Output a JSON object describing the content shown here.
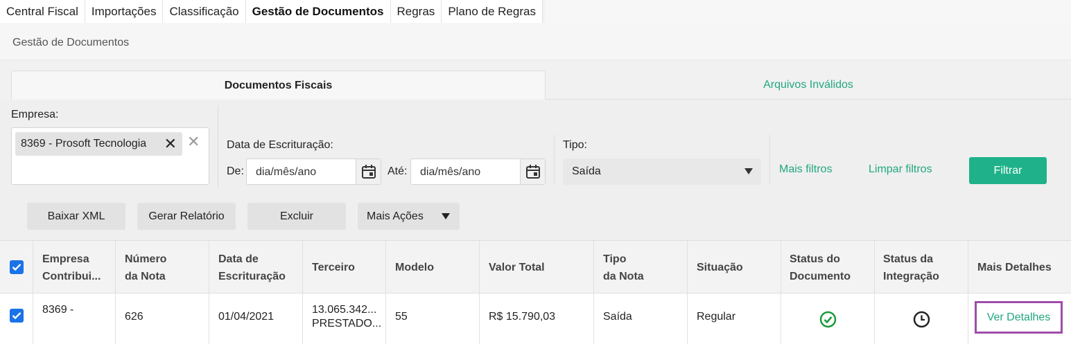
{
  "nav": {
    "tabs": [
      {
        "label": "Central Fiscal"
      },
      {
        "label": "Importações"
      },
      {
        "label": "Classificação"
      },
      {
        "label": "Gestão de Documentos",
        "active": true
      },
      {
        "label": "Regras"
      },
      {
        "label": "Plano de Regras"
      }
    ]
  },
  "breadcrumb": "Gestão de Documentos",
  "doc_tabs": {
    "active": "Documentos Fiscais",
    "inactive": "Arquivos Inválidos"
  },
  "filters": {
    "empresa_label": "Empresa:",
    "empresa_chip": "8369 - Prosoft Tecnologia",
    "data_label": "Data de Escrituração:",
    "de_label": "De:",
    "ate_label": "Até:",
    "date_placeholder": "dia/mês/ano",
    "tipo_label": "Tipo:",
    "tipo_value": "Saída",
    "mais_filtros": "Mais filtros",
    "limpar_filtros": "Limpar filtros",
    "filtrar": "Filtrar"
  },
  "actions": {
    "baixar_xml": "Baixar XML",
    "gerar_relatorio": "Gerar Relatório",
    "excluir": "Excluir",
    "mais_acoes": "Mais Ações"
  },
  "table": {
    "headers": {
      "empresa": [
        "Empresa",
        "Contribui..."
      ],
      "numero": [
        "Número",
        "da Nota"
      ],
      "data": [
        "Data de",
        "Escrituração"
      ],
      "terceiro": [
        "Terceiro"
      ],
      "modelo": [
        "Modelo"
      ],
      "valor": [
        "Valor Total"
      ],
      "tipo": [
        "Tipo",
        "da Nota"
      ],
      "situacao": [
        "Situação"
      ],
      "status_doc": [
        "Status do",
        "Documento"
      ],
      "status_int": [
        "Status da",
        "Integração"
      ],
      "detalhes": [
        "Mais Detalhes"
      ]
    },
    "rows": [
      {
        "empresa": "8369 -",
        "numero": "626",
        "data": "01/04/2021",
        "terceiro_1": "13.065.342...",
        "terceiro_2": "PRESTADO...",
        "modelo": "55",
        "valor": "R$ 15.790,03",
        "tipo": "Saída",
        "situacao": "Regular",
        "ver_detalhes": "Ver Detalhes"
      }
    ]
  },
  "colors": {
    "accent": "#1fb28a",
    "link": "#20a77f",
    "checkbox": "#1a73e8",
    "highlight": "#a04ca8"
  }
}
